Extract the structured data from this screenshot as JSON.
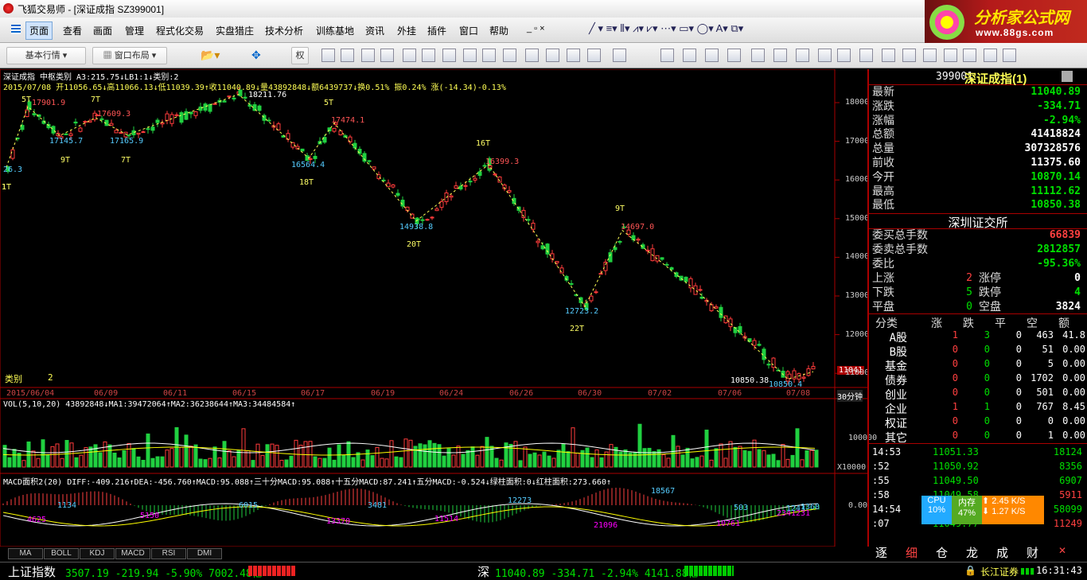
{
  "app": {
    "title": "飞狐交易师 - [深证成指 SZ399001]"
  },
  "menu": [
    "页面",
    "查看",
    "画面",
    "管理",
    "程式化交易",
    "实盘猎庄",
    "技术分析",
    "训练基地",
    "资讯",
    "外挂",
    "插件",
    "窗口",
    "帮助"
  ],
  "toolbar": {
    "basic": "基本行情",
    "layout": "窗口布局",
    "quan": "权"
  },
  "brand": {
    "name": "分析家公式网",
    "url": "www.88gs.com"
  },
  "chart": {
    "header1": "深证成指  中枢类别  A3:215.75↓LB1:1↓类别:2",
    "header2": "2015/07/08  开11056.65↓高11066.13↓低11039.39↑收11040.89↓量43892848↓额6439737↓换0.51% 振0.24% 涨(-14.34)-0.13%",
    "y_ticks": [
      "18000",
      "17000",
      "16000",
      "15000",
      "14000",
      "13000",
      "12000",
      "11000"
    ],
    "dates": [
      "2015/06/04",
      "06/09",
      "06/11",
      "06/15",
      "06/17",
      "06/19",
      "06/24",
      "06/26",
      "06/30",
      "07/02",
      "07/06",
      "07/08"
    ],
    "period": "30分钟",
    "last_price": "11041",
    "leibie_label": "类别",
    "leibie_val": "2",
    "labels": [
      {
        "t": "5T",
        "c": "#ffff66"
      },
      {
        "t": "7T",
        "c": "#ffff66"
      },
      {
        "t": "9T",
        "c": "#ffff66"
      },
      {
        "t": "7T",
        "c": "#ffff66"
      },
      {
        "t": "1T",
        "c": "#ffff66"
      },
      {
        "t": "5T",
        "c": "#ffff66"
      },
      {
        "t": "18T",
        "c": "#ffff66"
      },
      {
        "t": "16T",
        "c": "#ffff66"
      },
      {
        "t": "20T",
        "c": "#ffff66"
      },
      {
        "t": "9T",
        "c": "#ffff66"
      },
      {
        "t": "22T",
        "c": "#ffff66"
      },
      {
        "t": "17901.9",
        "c": "#ff5555"
      },
      {
        "t": "17609.3",
        "c": "#ff5555"
      },
      {
        "t": "17474.1",
        "c": "#ff5555"
      },
      {
        "t": "16399.3",
        "c": "#ff5555"
      },
      {
        "t": "14697.0",
        "c": "#ff5555"
      },
      {
        "t": "18211.76",
        "c": "#ffffff"
      },
      {
        "t": "10850.38",
        "c": "#ffffff"
      },
      {
        "t": "17145.7",
        "c": "#55ccff"
      },
      {
        "t": "17165.9",
        "c": "#55ccff"
      },
      {
        "t": "16564.4",
        "c": "#55ccff"
      },
      {
        "t": "14938.8",
        "c": "#55ccff"
      },
      {
        "t": "12723.2",
        "c": "#55ccff"
      },
      {
        "t": "10850.4",
        "c": "#55ccff"
      },
      {
        "t": "26.3",
        "c": "#55ccff"
      },
      {
        "t": "1T",
        "c": "#ffff66"
      }
    ],
    "vol_header": "VOL(5,10,20) 43892848↓MA1:39472064↑MA2:36238644↑MA3:34484584↑",
    "vol_ticks": [
      "100000",
      "X10000"
    ],
    "macd_header": "MACD面积2(20) DIFF:-409.216↑DEA:-456.760↑MACD:95.088↑三十分MACD:95.088↑十五分MACD:87.241↑五分MACD:-0.524↓绿柱面积:0↓红柱面积:273.660↑",
    "macd_tick": "0.00",
    "macd_labels": [
      "4625",
      "1134",
      "5150",
      "6015",
      "3481",
      "13370",
      "11514",
      "12273",
      "21096",
      "18567",
      "503",
      "10761",
      "2341",
      "1243",
      "1368",
      "231"
    ],
    "tabs": [
      "MA",
      "BOLL",
      "KDJ",
      "MACD",
      "RSI",
      "DMI"
    ]
  },
  "quote": {
    "code": "399001",
    "name": "深证成指(1)",
    "rows": [
      {
        "k": "最新",
        "v": "11040.89",
        "c": "green"
      },
      {
        "k": "涨跌",
        "v": "-334.71",
        "c": "green"
      },
      {
        "k": "涨幅",
        "v": "-2.94%",
        "c": "green"
      },
      {
        "k": "总额",
        "v": "41418824",
        "c": "white"
      },
      {
        "k": "总量",
        "v": "307328576",
        "c": "white"
      },
      {
        "k": "前收",
        "v": "11375.60",
        "c": "white"
      },
      {
        "k": "今开",
        "v": "10870.14",
        "c": "green"
      },
      {
        "k": "最高",
        "v": "11112.62",
        "c": "green"
      },
      {
        "k": "最低",
        "v": "10850.38",
        "c": "green"
      }
    ],
    "exchange": "深圳证交所",
    "rows2": [
      {
        "k": "委买总手数",
        "v": "66839",
        "c": "red"
      },
      {
        "k": "委卖总手数",
        "v": "2812857",
        "c": "green"
      },
      {
        "k": "委比",
        "v": "-95.36%",
        "c": "green"
      }
    ],
    "stats": [
      {
        "a": "上涨",
        "av": "2",
        "b": "涨停",
        "bv": "0"
      },
      {
        "a": "下跌",
        "av": "5",
        "b": "跌停",
        "bv": "4"
      },
      {
        "a": "平盘",
        "av": "0",
        "b": "空盘",
        "bv": "3824"
      }
    ],
    "table_head": [
      "分类",
      "涨",
      "跌",
      "平",
      "空",
      "额"
    ],
    "table": [
      [
        "A股",
        "1",
        "3",
        "0",
        "463",
        "41.8"
      ],
      [
        "B股",
        "0",
        "0",
        "0",
        "51",
        "0.00"
      ],
      [
        "基金",
        "0",
        "0",
        "0",
        "5",
        "0.00"
      ],
      [
        "债券",
        "0",
        "0",
        "0",
        "1702",
        "0.00"
      ],
      [
        "创业",
        "0",
        "0",
        "0",
        "501",
        "0.00"
      ],
      [
        "企业",
        "1",
        "1",
        "0",
        "767",
        "8.45"
      ],
      [
        "权证",
        "0",
        "0",
        "0",
        "0",
        "0.00"
      ],
      [
        "其它",
        "0",
        "0",
        "0",
        "1",
        "0.00"
      ]
    ],
    "ticks": [
      {
        "t": "14:53",
        "p": "11051.33",
        "v": "18124"
      },
      {
        "t": ":52",
        "p": "11050.92",
        "v": "8356"
      },
      {
        "t": ":55",
        "p": "11049.50",
        "v": "6907"
      },
      {
        "t": ":58",
        "p": "11049.58",
        "v": "5911"
      },
      {
        "t": "14:54",
        "p": "11049.37",
        "v": "58099"
      },
      {
        "t": ":07",
        "p": "11049.77",
        "v": "11249"
      }
    ],
    "cpu": {
      "cpu_label": "CPU",
      "cpu_val": "10%",
      "mem_label": "内存",
      "mem_val": "47%",
      "up": "2.45 K/S",
      "down": "1.27 K/S"
    },
    "bottom_tabs": [
      "逐",
      "细",
      "仓",
      "龙",
      "成",
      "财"
    ]
  },
  "status": {
    "sh_name": "上证指数",
    "sh": "3507.19 -219.94 -5.90% 7002.48亿",
    "sz_name": "深",
    "sz": "11040.89 -334.71 -2.94% 4141.88亿",
    "broker": "长江证券",
    "time": "16:31:43"
  }
}
